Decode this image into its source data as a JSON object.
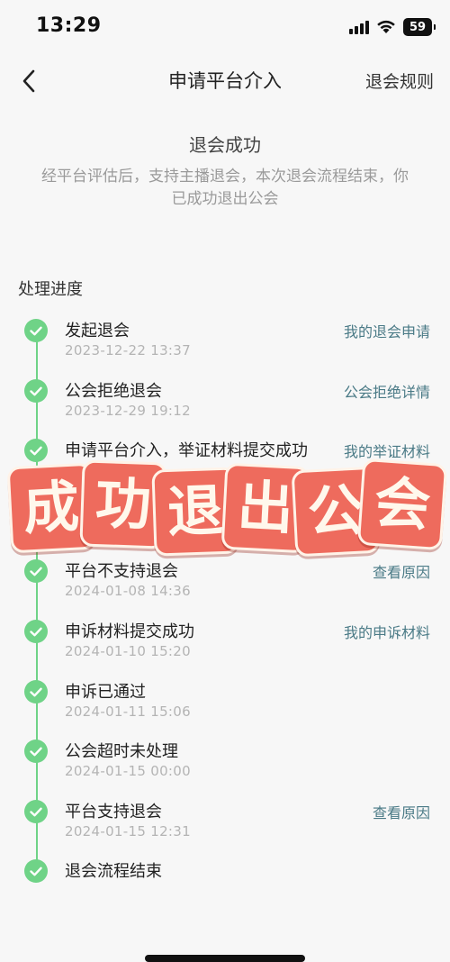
{
  "status_bar": {
    "time": "13:29",
    "battery": "59"
  },
  "nav": {
    "title": "申请平台介入",
    "right_link": "退会规则"
  },
  "result": {
    "title": "退会成功",
    "description": "经平台评估后，支持主播退会，本次退会流程结束，你已成功退出公会"
  },
  "progress": {
    "section_title": "处理进度",
    "steps": [
      {
        "label": "发起退会",
        "date": "2023-12-22 13:37",
        "link": "我的退会申请"
      },
      {
        "label": "公会拒绝退会",
        "date": "2023-12-29 19:12",
        "link": "公会拒绝详情"
      },
      {
        "label": "申请平台介入，举证材料提交成功",
        "date": "",
        "link": "我的举证材料"
      },
      {
        "label": "平台不支持退会",
        "date": "2024-01-08 14:36",
        "link": "查看原因"
      },
      {
        "label": "申诉材料提交成功",
        "date": "2024-01-10 15:20",
        "link": "我的申诉材料"
      },
      {
        "label": "申诉已通过",
        "date": "2024-01-11 15:06",
        "link": ""
      },
      {
        "label": "公会超时未处理",
        "date": "2024-01-15 00:00",
        "link": ""
      },
      {
        "label": "平台支持退会",
        "date": "2024-01-15 12:31",
        "link": "查看原因"
      },
      {
        "label": "退会流程结束",
        "date": "",
        "link": ""
      }
    ]
  },
  "overlay_stamp": {
    "characters": [
      "成",
      "功",
      "退",
      "出",
      "公",
      "会"
    ],
    "color": "#ee6b5d"
  },
  "colors": {
    "accent_green": "#6fd387",
    "link": "#4a7a86"
  }
}
